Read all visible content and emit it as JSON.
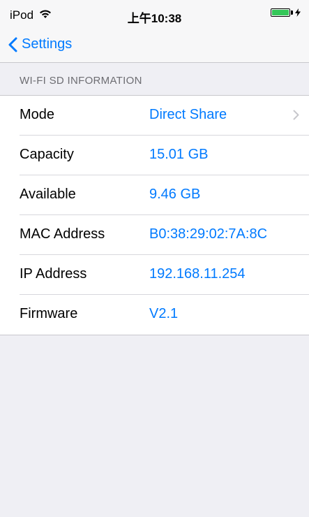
{
  "status_bar": {
    "device": "iPod",
    "wifi_icon": "wifi-icon",
    "time": "上午10:38",
    "battery_icon": "battery-charging-icon",
    "battery_level": 1.0
  },
  "nav": {
    "back_label": "Settings",
    "back_icon": "chevron-left-icon",
    "accent_color": "#007aff"
  },
  "section": {
    "title": "WI-FI SD INFORMATION"
  },
  "rows": [
    {
      "label": "Mode",
      "value": "Direct Share",
      "chevron": true
    },
    {
      "label": "Capacity",
      "value": "15.01 GB",
      "chevron": false
    },
    {
      "label": "Available",
      "value": "9.46 GB",
      "chevron": false
    },
    {
      "label": "MAC Address",
      "value": "B0:38:29:02:7A:8C",
      "chevron": false
    },
    {
      "label": "IP Address",
      "value": "192.168.11.254",
      "chevron": false
    },
    {
      "label": "Firmware",
      "value": "V2.1",
      "chevron": false
    }
  ]
}
